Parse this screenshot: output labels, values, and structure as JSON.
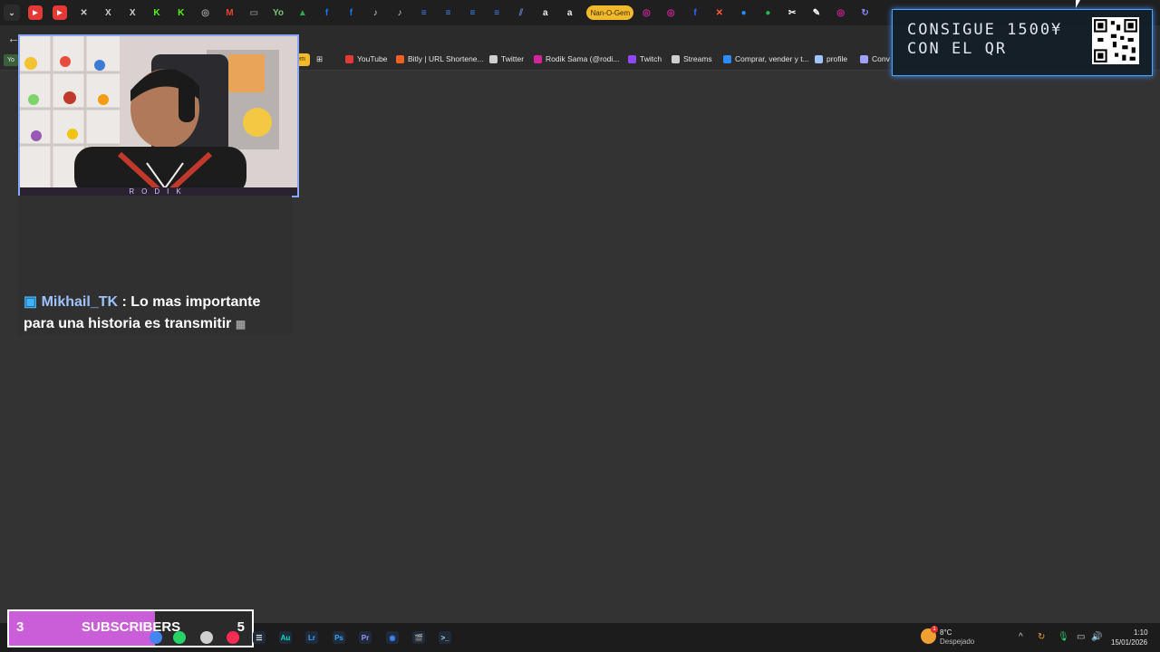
{
  "browser": {
    "tabs": [
      {
        "icon": "youtube-icon",
        "color": "#e53935"
      },
      {
        "icon": "youtube-icon",
        "color": "#e53935"
      },
      {
        "icon": "close-icon",
        "color": "#cfcfcf",
        "glyph": "✕"
      },
      {
        "icon": "x-icon",
        "color": "#cfcfcf",
        "glyph": "X"
      },
      {
        "icon": "x-icon",
        "color": "#cfcfcf",
        "glyph": "X"
      },
      {
        "icon": "kick-icon",
        "color": "#53fc18",
        "glyph": "K"
      },
      {
        "icon": "kick-icon",
        "color": "#53fc18",
        "glyph": "K"
      },
      {
        "icon": "circle-icon",
        "color": "#9e9e9e",
        "glyph": "◎"
      },
      {
        "icon": "gmail-icon",
        "color": "#ea4335",
        "glyph": "M"
      },
      {
        "icon": "generic-tab-icon",
        "color": "#7a7a7a",
        "glyph": "▭"
      },
      {
        "icon": "yo-icon",
        "color": "#7cc576",
        "glyph": "Yo"
      },
      {
        "icon": "drive-icon",
        "color": "#34a853",
        "glyph": "▲"
      },
      {
        "icon": "facebook-icon",
        "color": "#1877f2",
        "glyph": "f"
      },
      {
        "icon": "facebook-icon",
        "color": "#1877f2",
        "glyph": "f"
      },
      {
        "icon": "tiktok-icon",
        "color": "#cfcfcf",
        "glyph": "♪"
      },
      {
        "icon": "tiktok-icon",
        "color": "#cfcfcf",
        "glyph": "♪"
      },
      {
        "icon": "docs-icon",
        "color": "#4285f4",
        "glyph": "≡"
      },
      {
        "icon": "docs-icon",
        "color": "#4285f4",
        "glyph": "≡"
      },
      {
        "icon": "docs-icon",
        "color": "#4285f4",
        "glyph": "≡"
      },
      {
        "icon": "docs-icon",
        "color": "#4285f4",
        "glyph": "≡"
      },
      {
        "icon": "stripe-icon",
        "color": "#5f7fbf",
        "glyph": "⫽"
      },
      {
        "icon": "amazon-icon",
        "color": "#eeeeee",
        "glyph": "a"
      },
      {
        "icon": "amazon-icon",
        "color": "#eeeeee",
        "glyph": "a"
      },
      {
        "label": "Nan-O-Gem"
      },
      {
        "icon": "instagram-icon",
        "color": "#d6249f",
        "glyph": "◎"
      },
      {
        "icon": "instagram-icon",
        "color": "#d6249f",
        "glyph": "◎"
      },
      {
        "icon": "fansly-icon",
        "color": "#2b6cff",
        "glyph": "f"
      },
      {
        "icon": "sword-icon",
        "color": "#ff5a36",
        "glyph": "✕"
      },
      {
        "icon": "copilot-icon",
        "color": "#2a8cff",
        "glyph": "●"
      },
      {
        "icon": "spotify-icon",
        "color": "#1db954",
        "glyph": "●"
      },
      {
        "icon": "capcut-icon",
        "color": "#ffffff",
        "glyph": "✂"
      },
      {
        "icon": "notion-icon",
        "color": "#ffffff",
        "glyph": "✎"
      },
      {
        "icon": "instagram-icon",
        "color": "#d6249f",
        "glyph": "◎"
      },
      {
        "icon": "sync-icon",
        "color": "#8a8aff",
        "glyph": "↻"
      }
    ],
    "bookmarks": {
      "left_badge": "Yo",
      "gem_badge": "em",
      "items": [
        {
          "label": "YouTube",
          "color": "#e53935"
        },
        {
          "label": "Bitly | URL Shortene...",
          "color": "#ee6123"
        },
        {
          "label": "Twitter",
          "color": "#cfcfcf"
        },
        {
          "label": "Rodik Sama (@rodi...",
          "color": "#d6249f"
        },
        {
          "label": "Twitch",
          "color": "#9146ff"
        },
        {
          "label": "Streams",
          "color": "#cfcfcf"
        },
        {
          "label": "Comprar, vender y t...",
          "color": "#2a8cff"
        },
        {
          "label": "profile",
          "color": "#a0c4ff"
        },
        {
          "label": "Conv",
          "color": "#a0a0ff"
        }
      ]
    }
  },
  "overlay": {
    "webcam_banner": "RODIK",
    "chat": {
      "username": "Mikhail_TK",
      "separator": " : ",
      "message": "Lo mas importante para una historia es transmitir"
    },
    "qr_widget": {
      "line1": "CONSIGUE 1500¥",
      "line2": "CON EL QR"
    },
    "sub_goal": {
      "current": "3",
      "label": "SUBSCRIBERS",
      "target": "5",
      "progress": 0.6,
      "fill_color": "#c95ed8"
    }
  },
  "taskbar": {
    "apps": [
      {
        "icon": "chrome-icon",
        "color": "#4285f4"
      },
      {
        "icon": "whatsapp-icon",
        "color": "#25d366"
      },
      {
        "icon": "obs-icon",
        "color": "#cfcfcf"
      },
      {
        "icon": "tiktok-live-icon",
        "color": "#fe2c55"
      },
      {
        "icon": "streamlabs-icon",
        "color": "#e6e6e6",
        "glyph": "☰"
      },
      {
        "icon": "audition-icon",
        "color": "#00e4bb",
        "glyph": "Au"
      },
      {
        "icon": "lightroom-icon",
        "color": "#31a8ff",
        "glyph": "Lr"
      },
      {
        "icon": "photoshop-icon",
        "color": "#31a8ff",
        "glyph": "Ps"
      },
      {
        "icon": "premiere-icon",
        "color": "#9999ff",
        "glyph": "Pr"
      },
      {
        "icon": "chrome-icon",
        "color": "#4285f4",
        "glyph": "◉"
      },
      {
        "icon": "clapper-icon",
        "color": "#e6e6e6",
        "glyph": "🎬"
      },
      {
        "icon": "terminal-icon",
        "color": "#cfcfcf",
        "glyph": ">_"
      }
    ],
    "weather": {
      "badge": "1",
      "temp": "8°C",
      "desc": "Despejado"
    },
    "clock": {
      "time": "1:10",
      "date": "15/01/2026"
    }
  }
}
